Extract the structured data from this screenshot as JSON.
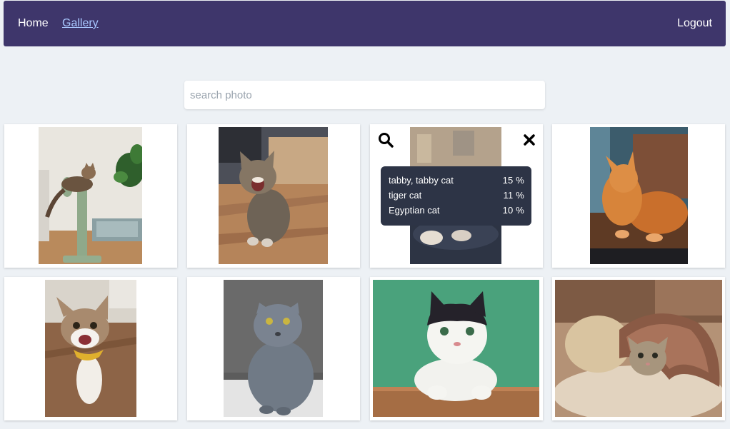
{
  "nav": {
    "home": "Home",
    "gallery": "Gallery",
    "logout": "Logout"
  },
  "search": {
    "placeholder": "search photo",
    "value": ""
  },
  "gallery": {
    "photos": [
      {
        "subject": "tabby cat on cactus scratching post"
      },
      {
        "subject": "yawning tabby kitten on wooden floor"
      },
      {
        "subject": "cat on lap (blurred)"
      },
      {
        "subject": "orange long-haired cat on table"
      },
      {
        "subject": "happy cat with yellow bandana"
      },
      {
        "subject": "grey british shorthair"
      },
      {
        "subject": "black and white cat on green background"
      },
      {
        "subject": "tabby kitten under blanket"
      }
    ],
    "selected_index": 2,
    "overlay_icons": [
      "search-icon",
      "close-icon"
    ]
  },
  "predictions": [
    {
      "label": "tabby, tabby cat",
      "score": "15 %"
    },
    {
      "label": "tiger cat",
      "score": "11 %"
    },
    {
      "label": "Egyptian cat",
      "score": "10 %"
    }
  ],
  "colors": {
    "navbar": "#3e366b",
    "page_bg": "#edf1f5",
    "tooltip_bg": "#2d3446",
    "active_link": "#a9c8ff"
  }
}
